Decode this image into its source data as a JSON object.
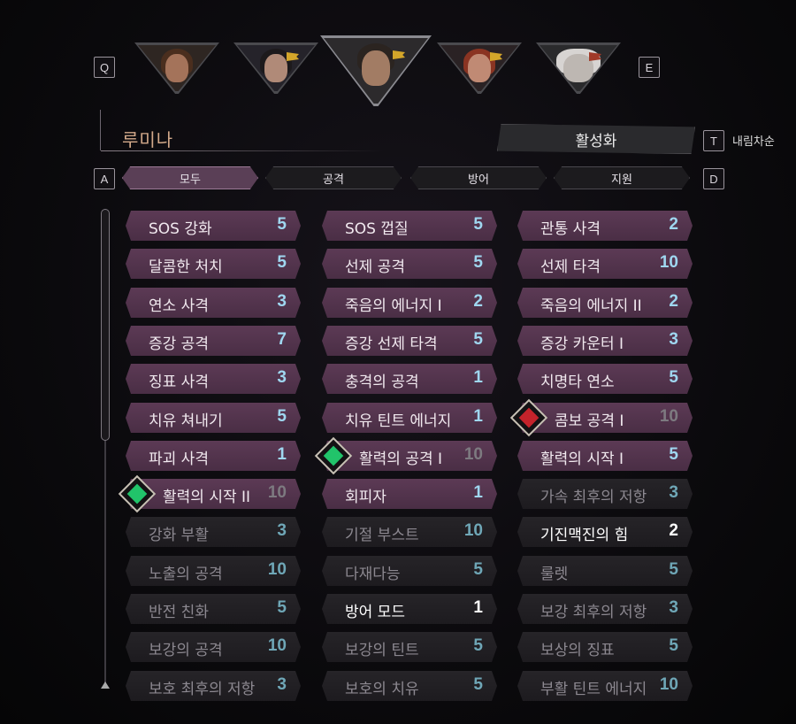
{
  "keys": {
    "prev": "Q",
    "next": "E",
    "sort": "T",
    "tab_prev": "A",
    "tab_next": "D"
  },
  "characters": [
    {
      "id": "char-1",
      "selected": false,
      "banner": false
    },
    {
      "id": "char-2",
      "selected": false,
      "banner": true
    },
    {
      "id": "char-3",
      "selected": true,
      "banner": true
    },
    {
      "id": "char-4",
      "selected": false,
      "banner": true
    },
    {
      "id": "char-5",
      "selected": false,
      "banner": true
    }
  ],
  "character_name": "루미나",
  "active_button": "활성화",
  "sort_label": "내림차순",
  "tabs": [
    "모두",
    "공격",
    "방어",
    "지원"
  ],
  "active_tab": 0,
  "skills": [
    [
      {
        "label": "SOS 강화",
        "level": "5",
        "active": true
      },
      {
        "label": "달콤한 처치",
        "level": "5",
        "active": true
      },
      {
        "label": "연소 사격",
        "level": "3",
        "active": true
      },
      {
        "label": "증강 공격",
        "level": "7",
        "active": true
      },
      {
        "label": "징표 사격",
        "level": "3",
        "active": true
      },
      {
        "label": "치유 쳐내기",
        "level": "5",
        "active": true
      },
      {
        "label": "파괴 사격",
        "level": "1",
        "active": true
      },
      {
        "label": "활력의 시작 II",
        "level": "10",
        "active": true,
        "icon": "green-gem-icon",
        "level_gray": true
      },
      {
        "label": "강화 부활",
        "level": "3",
        "active": false
      },
      {
        "label": "노출의 공격",
        "level": "10",
        "active": false
      },
      {
        "label": "반전 친화",
        "level": "5",
        "active": false
      },
      {
        "label": "보강의 공격",
        "level": "10",
        "active": false
      },
      {
        "label": "보호 최후의 저항",
        "level": "3",
        "active": false
      }
    ],
    [
      {
        "label": "SOS 껍질",
        "level": "5",
        "active": true
      },
      {
        "label": "선제 공격",
        "level": "5",
        "active": true
      },
      {
        "label": "죽음의 에너지 I",
        "level": "2",
        "active": true
      },
      {
        "label": "증강 선제 타격",
        "level": "5",
        "active": true
      },
      {
        "label": "충격의 공격",
        "level": "1",
        "active": true
      },
      {
        "label": "치유 틴트 에너지",
        "level": "1",
        "active": true
      },
      {
        "label": "활력의 공격 I",
        "level": "10",
        "active": true,
        "icon": "green-gem-icon",
        "level_gray": true
      },
      {
        "label": "회피자",
        "level": "1",
        "active": true
      },
      {
        "label": "기절 부스트",
        "level": "10",
        "active": false
      },
      {
        "label": "다재다능",
        "level": "5",
        "active": false
      },
      {
        "label": "방어 모드",
        "level": "1",
        "active": false,
        "highlight": true
      },
      {
        "label": "보강의 틴트",
        "level": "5",
        "active": false
      },
      {
        "label": "보호의 치유",
        "level": "5",
        "active": false
      }
    ],
    [
      {
        "label": "관통 사격",
        "level": "2",
        "active": true
      },
      {
        "label": "선제 타격",
        "level": "10",
        "active": true
      },
      {
        "label": "죽음의 에너지 II",
        "level": "2",
        "active": true
      },
      {
        "label": "증강 카운터 I",
        "level": "3",
        "active": true
      },
      {
        "label": "치명타 연소",
        "level": "5",
        "active": true
      },
      {
        "label": "콤보 공격 I",
        "level": "10",
        "active": true,
        "icon": "red-gem-icon",
        "level_gray": true
      },
      {
        "label": "활력의 시작 I",
        "level": "5",
        "active": true
      },
      {
        "label": "가속 최후의 저항",
        "level": "3",
        "active": false
      },
      {
        "label": "기진맥진의 힘",
        "level": "2",
        "active": false,
        "highlight": true
      },
      {
        "label": "룰렛",
        "level": "5",
        "active": false
      },
      {
        "label": "보강 최후의 저항",
        "level": "3",
        "active": false
      },
      {
        "label": "보상의 징표",
        "level": "5",
        "active": false
      },
      {
        "label": "부활 틴트 에너지",
        "level": "10",
        "active": false
      }
    ]
  ],
  "colors": {
    "accent_active": "#5c3a55",
    "level_blue": "#9fd7f0",
    "gem_green": "#21c46a",
    "gem_red": "#c4232b"
  }
}
